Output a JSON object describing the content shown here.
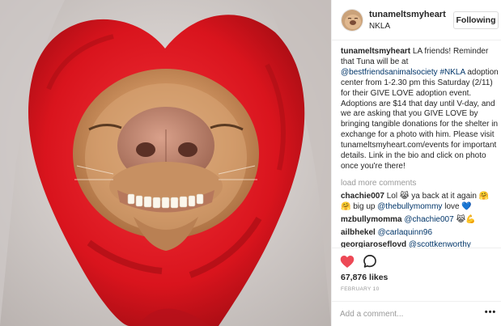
{
  "header": {
    "username": "tunameltsmyheart",
    "location": "NKLA",
    "follow_label": "Following"
  },
  "caption": {
    "username": "tunameltsmyheart",
    "text_1": " LA friends! Reminder that Tuna will be at ",
    "mention": "@bestfriendsanimalsociety",
    "text_2": " ",
    "hashtag": "#NKLA",
    "text_3": " adoption center from 1-2.30 pm this Saturday (2/11) for their GIVE LOVE adoption event. Adoptions are $14 that day until V-day, and we are asking that you GIVE LOVE by bringing tangible donations for the shelter in exchange for a photo with him. Please visit tunameltsmyheart.com/events for important details. Link in the bio and click on photo once you're there!"
  },
  "load_more_label": "load more comments",
  "comments": [
    {
      "username": "chachie007",
      "text_a": " Lol ",
      "emoji_a": "😹",
      "text_b": " ya back at it again ",
      "emoji_b": "🤗",
      "emoji_c": "🤗",
      "text_c": " big up ",
      "mention": "@thebullymommy",
      "text_d": " love ",
      "emoji_d": "💙"
    },
    {
      "username": "mzbullymomma",
      "mention": "@chachie007",
      "emoji_a": "😹",
      "emoji_b": "💪"
    },
    {
      "username": "ailbhekel",
      "mention": "@carlaquinn96"
    },
    {
      "username": "georgiaroseflovd",
      "mention": "@scottkenworthy"
    }
  ],
  "actions": {
    "likes": "67,876 likes",
    "date": "FEBRUARY 10"
  },
  "add_comment": {
    "placeholder": "Add a comment...",
    "more_label": "•••"
  },
  "colors": {
    "heart_red": "#ed4956",
    "link_blue": "#003569",
    "muted_gray": "#999999",
    "blanket_red": "#d9141d"
  },
  "icons": {
    "like": "heart-filled-icon",
    "comment": "speech-bubble-icon",
    "more": "ellipsis-icon"
  }
}
